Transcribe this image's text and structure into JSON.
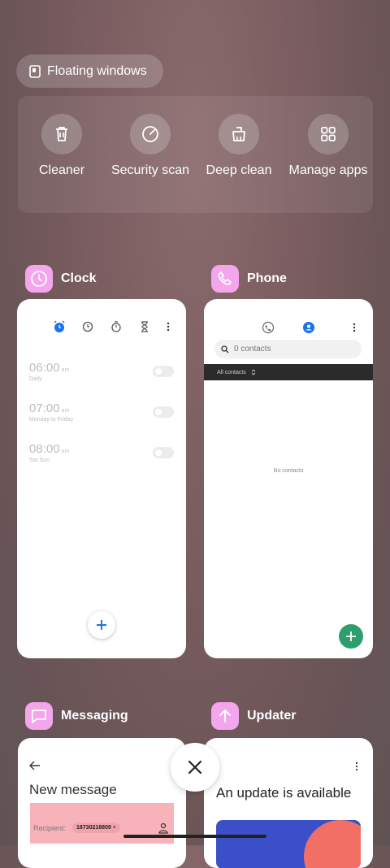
{
  "floating_windows": {
    "label": "Floating windows",
    "icon": "floating-window-icon"
  },
  "quick_actions": [
    {
      "label": "Cleaner",
      "icon": "trash-icon"
    },
    {
      "label": "Security scan",
      "icon": "shield-scan-icon"
    },
    {
      "label": "Deep clean",
      "icon": "broom-icon"
    },
    {
      "label": "Manage apps",
      "icon": "grid-icon"
    }
  ],
  "apps": {
    "clock": {
      "name": "Clock",
      "icon": "clock-icon",
      "tabs": [
        "alarm-icon",
        "world-clock-icon",
        "stopwatch-icon",
        "timer-icon",
        "more-icon"
      ],
      "alarms": [
        {
          "time": "06:00",
          "ampm": "am",
          "days": "Daily"
        },
        {
          "time": "07:00",
          "ampm": "am",
          "days": "Monday to Friday"
        },
        {
          "time": "08:00",
          "ampm": "am",
          "days": "Sat Sun"
        }
      ]
    },
    "phone": {
      "name": "Phone",
      "icon": "phone-icon",
      "search_placeholder": "0 contacts",
      "filter_label": "All contacts",
      "empty_text": "No contacts"
    },
    "messaging": {
      "name": "Messaging",
      "icon": "message-icon",
      "title": "New message",
      "recipient_label": "Recipient:",
      "recipient_chip": "18730218809",
      "chip_remove": "×"
    },
    "updater": {
      "name": "Updater",
      "icon": "arrow-up-icon",
      "title": "An update is available"
    }
  },
  "colors": {
    "app_icon_bg": "#f3a6ec",
    "phone_fab": "#2e9e6e",
    "clock_accent": "#1a73e8",
    "recipient_bg": "#f7b3b9"
  }
}
